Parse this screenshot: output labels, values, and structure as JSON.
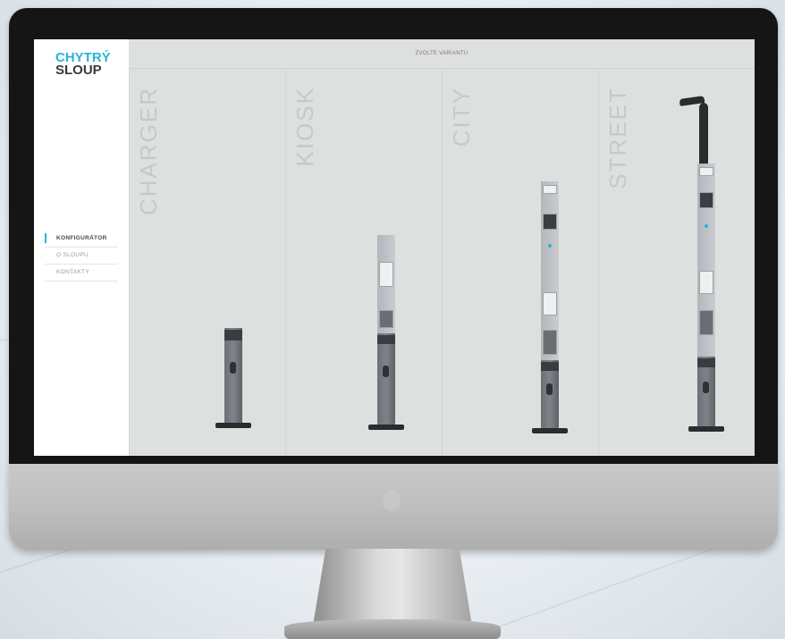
{
  "brand": {
    "line1": "CHYTRÝ",
    "line2": "SLOUP",
    "accent_color": "#2bb3d8"
  },
  "nav": {
    "items": [
      {
        "label": "KONFIGURÁTOR",
        "active": true
      },
      {
        "label": "O SLOUPU",
        "active": false
      },
      {
        "label": "KONTAKTY",
        "active": false
      }
    ]
  },
  "header": {
    "title": "ZVOLTE VARIANTU"
  },
  "variants": [
    {
      "label": "CHARGER"
    },
    {
      "label": "KIOSK"
    },
    {
      "label": "CITY"
    },
    {
      "label": "STREET"
    }
  ]
}
